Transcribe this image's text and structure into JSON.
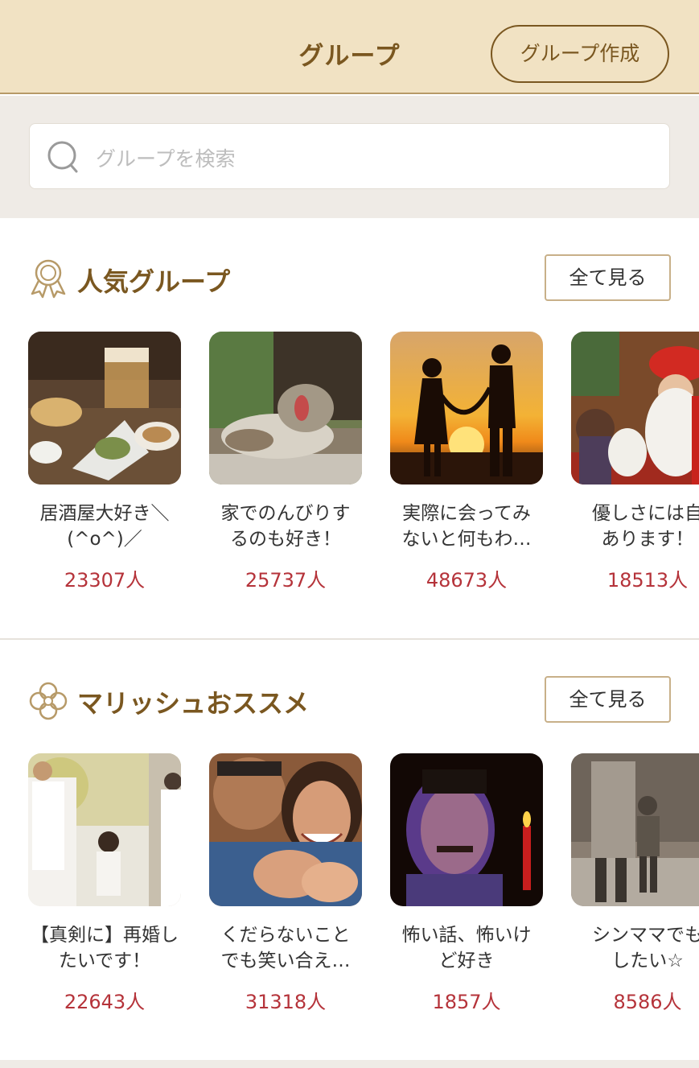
{
  "header": {
    "title": "グループ",
    "create_label": "グループ作成"
  },
  "search": {
    "placeholder": "グループを検索"
  },
  "popular": {
    "title": "人気グループ",
    "see_all": "全て見る",
    "icon": "award-ribbon-icon",
    "items": [
      {
        "name": "居酒屋大好き＼\n(^o^)／",
        "count": "23307人",
        "image": "izakaya-food-photo"
      },
      {
        "name": "家でのんびりす\nるのも好き！",
        "count": "25737人",
        "image": "yawning-cat-photo"
      },
      {
        "name": "実際に会ってみ\nないと何もわ…",
        "count": "48673人",
        "image": "sunset-couple-silhouette-photo"
      },
      {
        "name": "優しさには自\nあります！",
        "count": "18513人",
        "image": "santa-child-photo"
      }
    ]
  },
  "recommended": {
    "title": "マリッシュおススメ",
    "see_all": "全て見る",
    "icon": "clover-icon",
    "items": [
      {
        "name": "【真剣に】再婚し\nたいです！",
        "count": "22643人",
        "image": "family-walk-photo"
      },
      {
        "name": "くだらないこと\nでも笑い合え…",
        "count": "31318人",
        "image": "laughing-couple-photo"
      },
      {
        "name": "怖い話、怖いけ\nど好き",
        "count": "1857人",
        "image": "candle-storyteller-photo"
      },
      {
        "name": "シンママでも\nしたい☆",
        "count": "8586人",
        "image": "mother-child-sepia-photo"
      }
    ]
  },
  "colors": {
    "header_bg": "#f1e2c3",
    "brand_brown": "#7a5720",
    "count_red": "#b5333a",
    "search_bg": "#efebe6"
  }
}
